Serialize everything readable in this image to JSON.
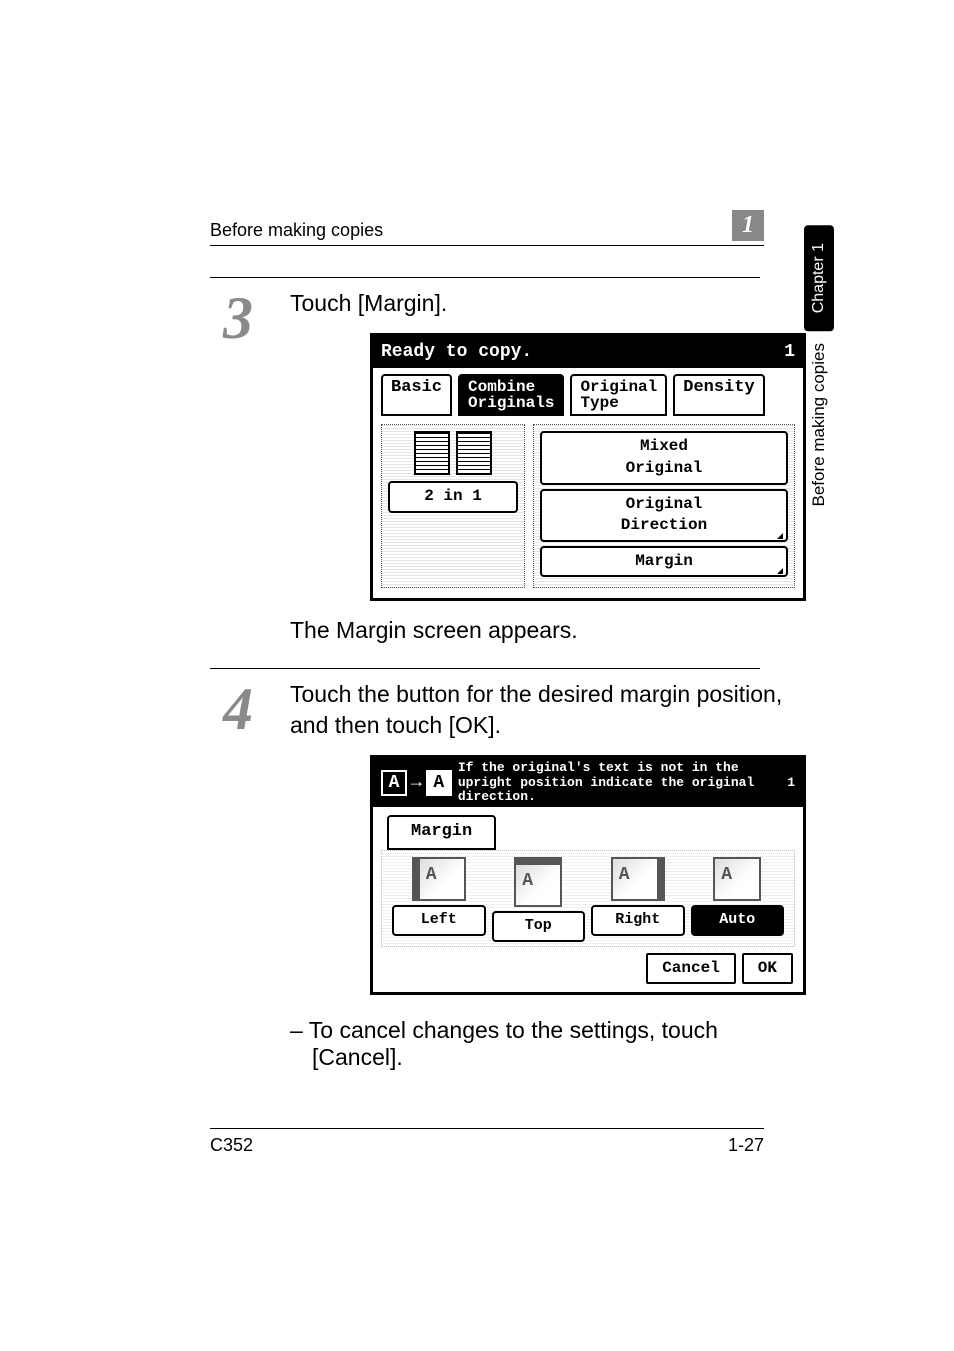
{
  "runhead": {
    "left": "Before making copies",
    "right_num": "1"
  },
  "side": {
    "chapter": "Chapter 1",
    "label": "Before making copies"
  },
  "step3": {
    "num": "3",
    "instruction": "Touch [Margin].",
    "result": "The Margin screen appears.",
    "lcd": {
      "status": "Ready to copy.",
      "count": "1",
      "tabs": {
        "basic": "Basic",
        "combine_top": "Combine",
        "combine_bottom": "Originals",
        "orig_top": "Original",
        "orig_bottom": "Type",
        "density": "Density"
      },
      "left_option": "2 in 1",
      "right_options": {
        "mixed": "Mixed\nOriginal",
        "direction": "Original\nDirection",
        "margin": "Margin"
      }
    }
  },
  "step4": {
    "num": "4",
    "instruction": "Touch the button for the desired margin position, and then touch [OK].",
    "bullet": "– To cancel changes to the settings, touch [Cancel].",
    "lcd": {
      "hint_text": "If the original's text is not in the upright position indicate the original direction.",
      "count": "1",
      "tab": "Margin",
      "options": {
        "left": "Left",
        "top": "Top",
        "right": "Right",
        "auto": "Auto"
      },
      "cancel": "Cancel",
      "ok": "OK"
    }
  },
  "footer": {
    "left": "C352",
    "right": "1-27"
  }
}
